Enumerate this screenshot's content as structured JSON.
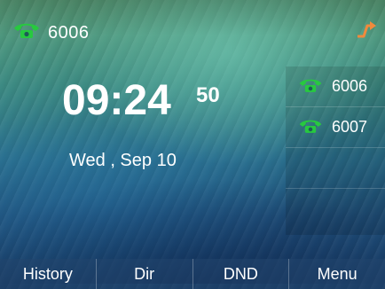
{
  "status_bar": {
    "account_label": "6006",
    "account_icon": "phone-icon",
    "forward_icon": "call-forward-icon",
    "colors": {
      "phone_icon": "#27c93f",
      "forward_icon": "#f08a3c"
    }
  },
  "clock": {
    "time": "09:24",
    "seconds": "50",
    "date": "Wed , Sep 10"
  },
  "line_keys": [
    {
      "label": "6006",
      "icon": "phone-icon"
    },
    {
      "label": "6007",
      "icon": "phone-icon"
    },
    {
      "label": "",
      "icon": ""
    },
    {
      "label": "",
      "icon": ""
    }
  ],
  "softkeys": [
    {
      "label": "History"
    },
    {
      "label": "Dir"
    },
    {
      "label": "DND"
    },
    {
      "label": "Menu"
    }
  ]
}
